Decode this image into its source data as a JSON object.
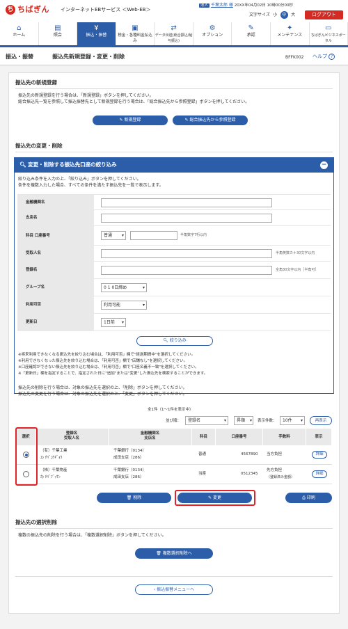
{
  "header": {
    "logo_mark": "ち",
    "logo_text": "ちばぎん",
    "service_name": "インターネットEBサービス ＜Web-EB＞",
    "user_tag": "法人",
    "user_name": "千葉太郎 様",
    "datetime": "20XX年04月02日 10時00分00秒",
    "font_size_label": "文字サイズ",
    "font_small": "小",
    "font_medium": "中",
    "font_large": "大",
    "logout_label": "ログアウト"
  },
  "nav": {
    "items": [
      {
        "label": "ホーム",
        "icon": "home-icon",
        "glyph": "⌂"
      },
      {
        "label": "照会",
        "icon": "inquiry-icon",
        "glyph": "▤"
      },
      {
        "label": "振込・振替",
        "icon": "transfer-icon",
        "glyph": "¥"
      },
      {
        "label": "税金・各種料金払込み",
        "icon": "tax-icon",
        "glyph": "▣"
      },
      {
        "label": "データ伝送(総合振込/給与振込)",
        "icon": "data-icon",
        "glyph": "⇄"
      },
      {
        "label": "オプション",
        "icon": "option-icon",
        "glyph": "⚙"
      },
      {
        "label": "承認",
        "icon": "approve-icon",
        "glyph": "✎"
      },
      {
        "label": "メンテナンス",
        "icon": "maintenance-icon",
        "glyph": "✦"
      },
      {
        "label": "ちばぎんビジネスポータル",
        "icon": "portal-icon",
        "glyph": "▭"
      }
    ]
  },
  "page": {
    "title": "振込・振替",
    "subtitle": "振込先新規登録・変更・削除",
    "code": "BFFK002",
    "help_label": "ヘルプ"
  },
  "new_section": {
    "title": "振込先の新規登録",
    "desc1": "振込先の新規登録を行う場合は、「新規登録」ボタンを押してください。",
    "desc2": "総合振込先一覧を参照して振込振替先として新規登録を行う場合は、「総合振込先から参照登録」ボタンを押してください。",
    "btn_new": "新規登録",
    "btn_ref": "総合振込先から参照登録"
  },
  "change_section": {
    "title": "振込先の変更・削除"
  },
  "filter": {
    "title": "変更・削除する振込先口座の絞り込み",
    "desc1": "絞り込み条件を入力の上、「絞り込み」ボタンを押してください。",
    "desc2": "条件を複数入力した場合、すべての条件を満たす振込先を一覧で表示します。",
    "rows": {
      "bank": "金融機関名",
      "branch": "支店名",
      "account": "科目 口座番号",
      "account_type": "普通",
      "account_hint": "半角数字7桁以内",
      "recipient": "受取人名",
      "recipient_hint": "半角英数カナ30文字以内",
      "reg_name": "登録名",
      "reg_name_hint": "全角30文字以内［半角可］",
      "group": "グループ名",
      "group_value": "0 1 0日締め",
      "availability": "利用可否",
      "availability_value": "利用可能",
      "updated": "更新日",
      "updated_value": "1日前"
    },
    "btn_filter": "絞り込み",
    "notes": [
      "※将来利用できなくなる振込先を絞り込む場合は、「利用可否」欄で\"経過期間中\"を選択してください。",
      "※利用できなくなった振込先を絞り込む場合は、「利用可否」欄で\"店舗なし\"を選択してください。",
      "※口座確認ができない振込先を絞り込む場合は、「利用可否」欄で\"口座名義不一致\"を選択してください。",
      "※「更新日」欄を指定することで、指定された日に\"追加\"または\"変更\"した振込先を検索することができます。"
    ]
  },
  "list_section": {
    "desc1": "振込先の削除を行う場合は、対象の振込先を選択の上、「削除」ボタンを押してください。",
    "desc2": "振込先の変更を行う場合は、対象の振込先を選択の上、「変更」ボタンを押してください。",
    "count": "全1件（1〜1件を表示中）",
    "sort_label": "並び順：",
    "sort_value": "登録名",
    "order_value": "昇順",
    "per_page_label": "表示件数：",
    "per_page_value": "10件",
    "btn_redisplay": "再表示",
    "headers": {
      "select": "選択",
      "reg_name": "登録名",
      "recipient": "受取人名",
      "bank": "金融機関名",
      "branch": "支店名",
      "kind": "科目",
      "account": "口座番号",
      "fee": "手数料",
      "view": "表示"
    },
    "rows": [
      {
        "reg_name": "（有）千葉工業",
        "recipient": "ﾕ) ﾁﾊﾞｺｳｷﾞｮｳ",
        "bank": "千葉銀行（0134）",
        "branch": "成田支店（286）",
        "kind": "普通",
        "account": "4567890",
        "fee": "当方負担",
        "fee2": "",
        "detail": "詳細",
        "selected": true
      },
      {
        "reg_name": "（株）千葉物産",
        "recipient": "ｶ) ﾁﾊﾞﾌﾞｯｻﾝ",
        "bank": "千葉銀行（0134）",
        "branch": "成田支店（286）",
        "kind": "当座",
        "account": "0512345",
        "fee": "先方負担",
        "fee2": "（登録済み金額）",
        "detail": "詳細",
        "selected": false
      }
    ],
    "btn_delete": "削除",
    "btn_change": "変更",
    "btn_print": "印刷"
  },
  "multi_section": {
    "title": "振込先の選択削除",
    "desc": "複数の振込先の削除を行う場合は、「複数選択削除」ボタンを押してください。",
    "btn": "複数選択削除へ"
  },
  "back_button": "振込振替メニューへ",
  "colors": {
    "brand_red": "#d7281e",
    "primary_blue": "#2c5da8",
    "highlight_red": "#e0232a"
  }
}
